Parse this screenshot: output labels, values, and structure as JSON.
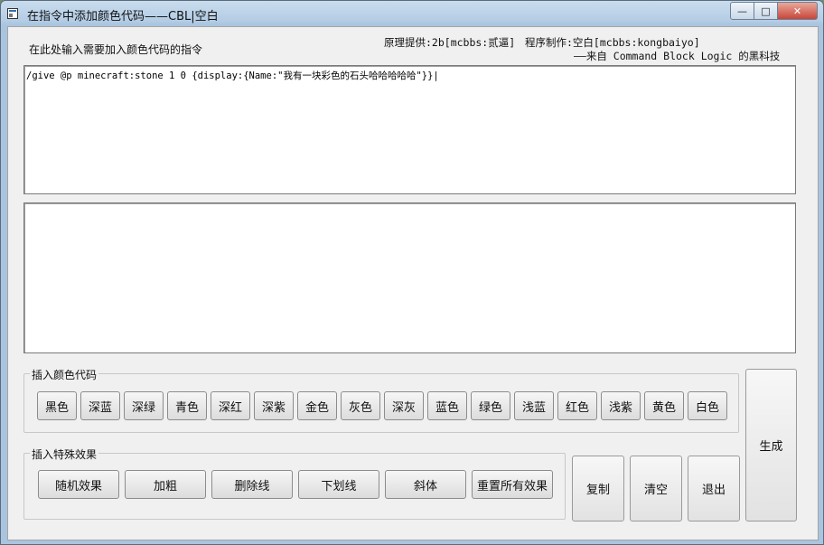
{
  "window": {
    "title": "在指令中添加颜色代码——CBL|空白",
    "minimize_label": "—",
    "maximize_label": "□",
    "close_label": "✕"
  },
  "header": {
    "instruction": "在此处输入需要加入颜色代码的指令",
    "credits_principle": "原理提供:2b[mcbbs:贰逼]",
    "credits_author": "程序制作:空白[mcbbs:kongbaiyo]",
    "credits_source": "——来自 Command Block Logic 的黑科技"
  },
  "input": {
    "value": "/give @p minecraft:stone 1 0 {display:{Name:\"我有一块彩色的石头哈哈哈哈哈\"}}|"
  },
  "output": {
    "value": ""
  },
  "color_group": {
    "legend": "插入颜色代码",
    "buttons": [
      "黑色",
      "深蓝",
      "深绿",
      "青色",
      "深红",
      "深紫",
      "金色",
      "灰色",
      "深灰",
      "蓝色",
      "绿色",
      "浅蓝",
      "红色",
      "浅紫",
      "黄色",
      "白色"
    ]
  },
  "effects_group": {
    "legend": "插入特殊效果",
    "buttons": [
      "随机效果",
      "加粗",
      "删除线",
      "下划线",
      "斜体",
      "重置所有效果"
    ]
  },
  "actions": {
    "generate": "生成",
    "copy": "复制",
    "clear": "清空",
    "exit": "退出"
  }
}
